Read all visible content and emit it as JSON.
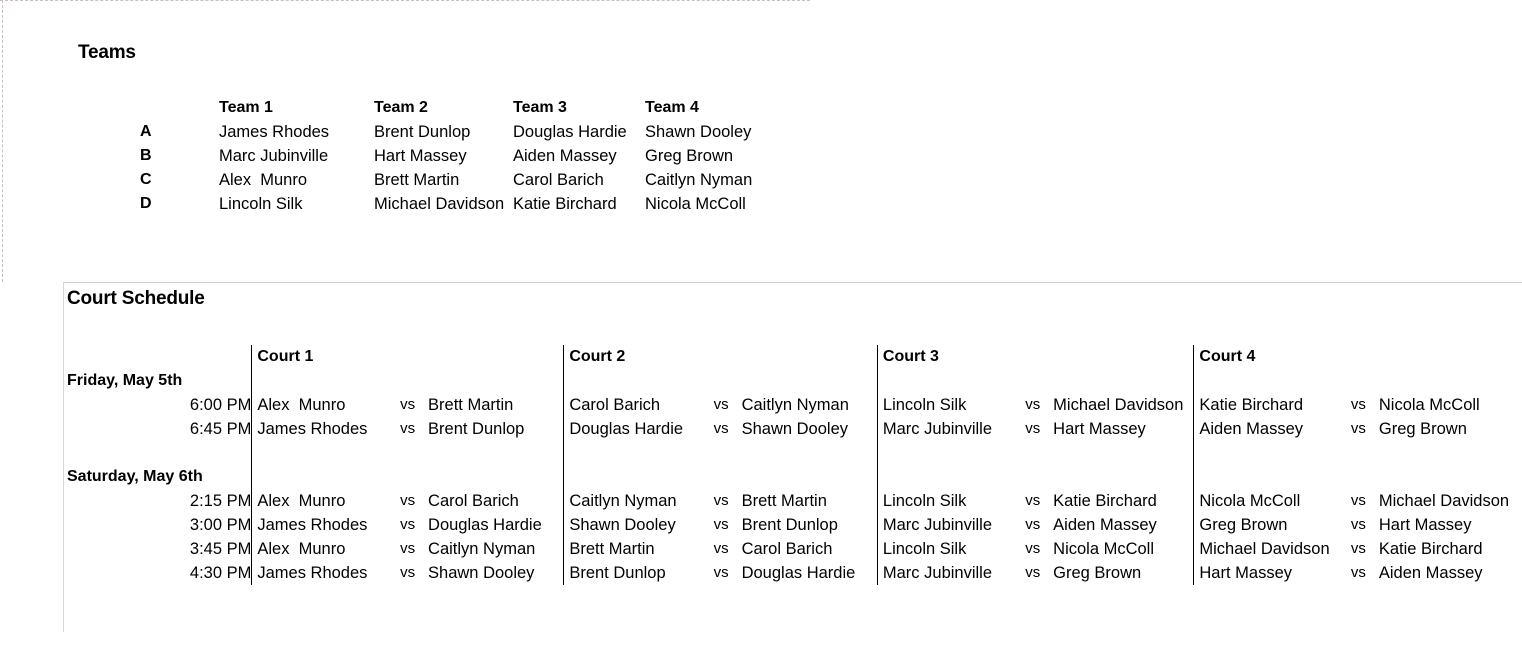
{
  "teams": {
    "title": "Teams",
    "row_labels": [
      "A",
      "B",
      "C",
      "D"
    ],
    "headers": [
      "Team 1",
      "Team 2",
      "Team 3",
      "Team 4"
    ],
    "columns": [
      [
        "James Rhodes",
        "Marc Jubinville",
        "Alex  Munro",
        "Lincoln Silk"
      ],
      [
        "Brent Dunlop",
        "Hart Massey",
        "Brett Martin",
        "Michael Davidson"
      ],
      [
        "Douglas Hardie",
        "Aiden Massey",
        "Carol Barich",
        "Katie Birchard"
      ],
      [
        "Shawn Dooley",
        "Greg Brown",
        "Caitlyn Nyman",
        "Nicola McColl"
      ]
    ]
  },
  "schedule": {
    "title": "Court Schedule",
    "court_headers": [
      "Court 1",
      "Court 2",
      "Court 3",
      "Court 4"
    ],
    "vs_label": "vs",
    "days": [
      {
        "label": "Friday, May 5th",
        "times": [
          "6:00 PM",
          "6:45 PM"
        ],
        "courts": [
          [
            {
              "p1": "Alex  Munro",
              "p2": "Brett Martin"
            },
            {
              "p1": "James Rhodes",
              "p2": "Brent Dunlop"
            }
          ],
          [
            {
              "p1": "Carol Barich",
              "p2": "Caitlyn Nyman"
            },
            {
              "p1": "Douglas Hardie",
              "p2": "Shawn Dooley"
            }
          ],
          [
            {
              "p1": "Lincoln Silk",
              "p2": "Michael Davidson"
            },
            {
              "p1": "Marc Jubinville",
              "p2": "Hart Massey"
            }
          ],
          [
            {
              "p1": "Katie Birchard",
              "p2": "Nicola McColl"
            },
            {
              "p1": "Aiden Massey",
              "p2": "Greg Brown"
            }
          ]
        ]
      },
      {
        "label": "Saturday, May 6th",
        "times": [
          "2:15 PM",
          "3:00 PM",
          "3:45 PM",
          "4:30 PM"
        ],
        "courts": [
          [
            {
              "p1": "Alex  Munro",
              "p2": "Carol Barich"
            },
            {
              "p1": "James Rhodes",
              "p2": "Douglas Hardie"
            },
            {
              "p1": "Alex  Munro",
              "p2": "Caitlyn Nyman"
            },
            {
              "p1": "James Rhodes",
              "p2": "Shawn Dooley"
            }
          ],
          [
            {
              "p1": "Caitlyn Nyman",
              "p2": "Brett Martin"
            },
            {
              "p1": "Shawn Dooley",
              "p2": "Brent Dunlop"
            },
            {
              "p1": "Brett Martin",
              "p2": "Carol Barich"
            },
            {
              "p1": "Brent Dunlop",
              "p2": "Douglas Hardie"
            }
          ],
          [
            {
              "p1": "Lincoln Silk",
              "p2": "Katie Birchard"
            },
            {
              "p1": "Marc Jubinville",
              "p2": "Aiden Massey"
            },
            {
              "p1": "Lincoln Silk",
              "p2": "Nicola McColl"
            },
            {
              "p1": "Marc Jubinville",
              "p2": "Greg Brown"
            }
          ],
          [
            {
              "p1": "Nicola McColl",
              "p2": "Michael Davidson"
            },
            {
              "p1": "Greg Brown",
              "p2": "Hart Massey"
            },
            {
              "p1": "Michael Davidson",
              "p2": "Katie Birchard"
            },
            {
              "p1": "Hart Massey",
              "p2": "Aiden Massey"
            }
          ]
        ]
      }
    ]
  }
}
